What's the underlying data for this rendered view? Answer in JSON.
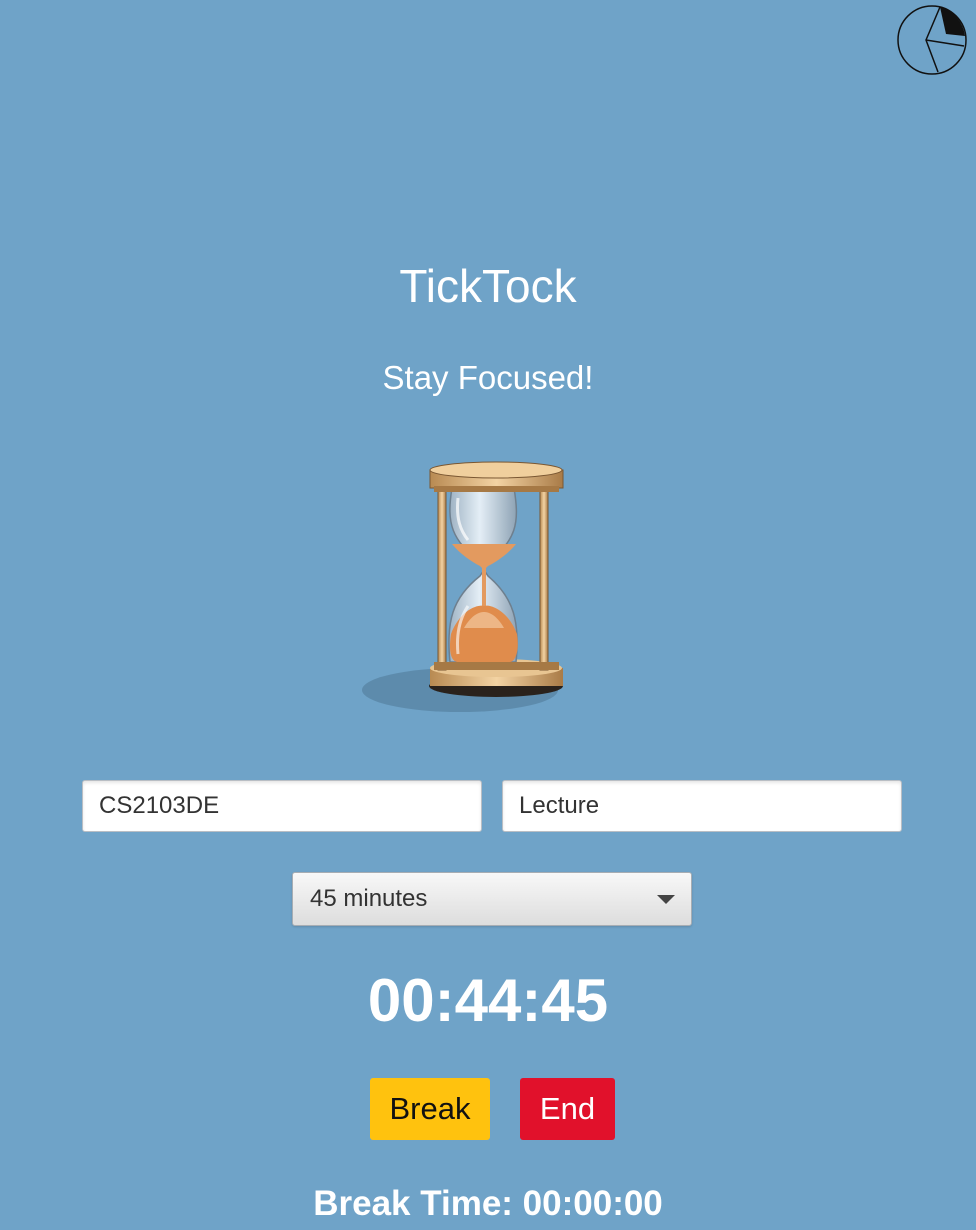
{
  "app": {
    "title": "TickTock",
    "tagline": "Stay Focused!"
  },
  "header": {
    "stats_icon": "pie-chart-icon"
  },
  "illustration": {
    "icon": "hourglass-icon"
  },
  "form": {
    "course_value": "CS2103DE",
    "type_value": "Lecture",
    "duration_value": "45 minutes"
  },
  "timer": {
    "display": "00:44:45"
  },
  "actions": {
    "break_label": "Break",
    "end_label": "End"
  },
  "break_time": {
    "display": "Break Time: 00:00:00"
  },
  "colors": {
    "background": "#6fa3c8",
    "break_button": "#ffc20e",
    "end_button": "#e1112b",
    "sand": "#e39a5f"
  }
}
